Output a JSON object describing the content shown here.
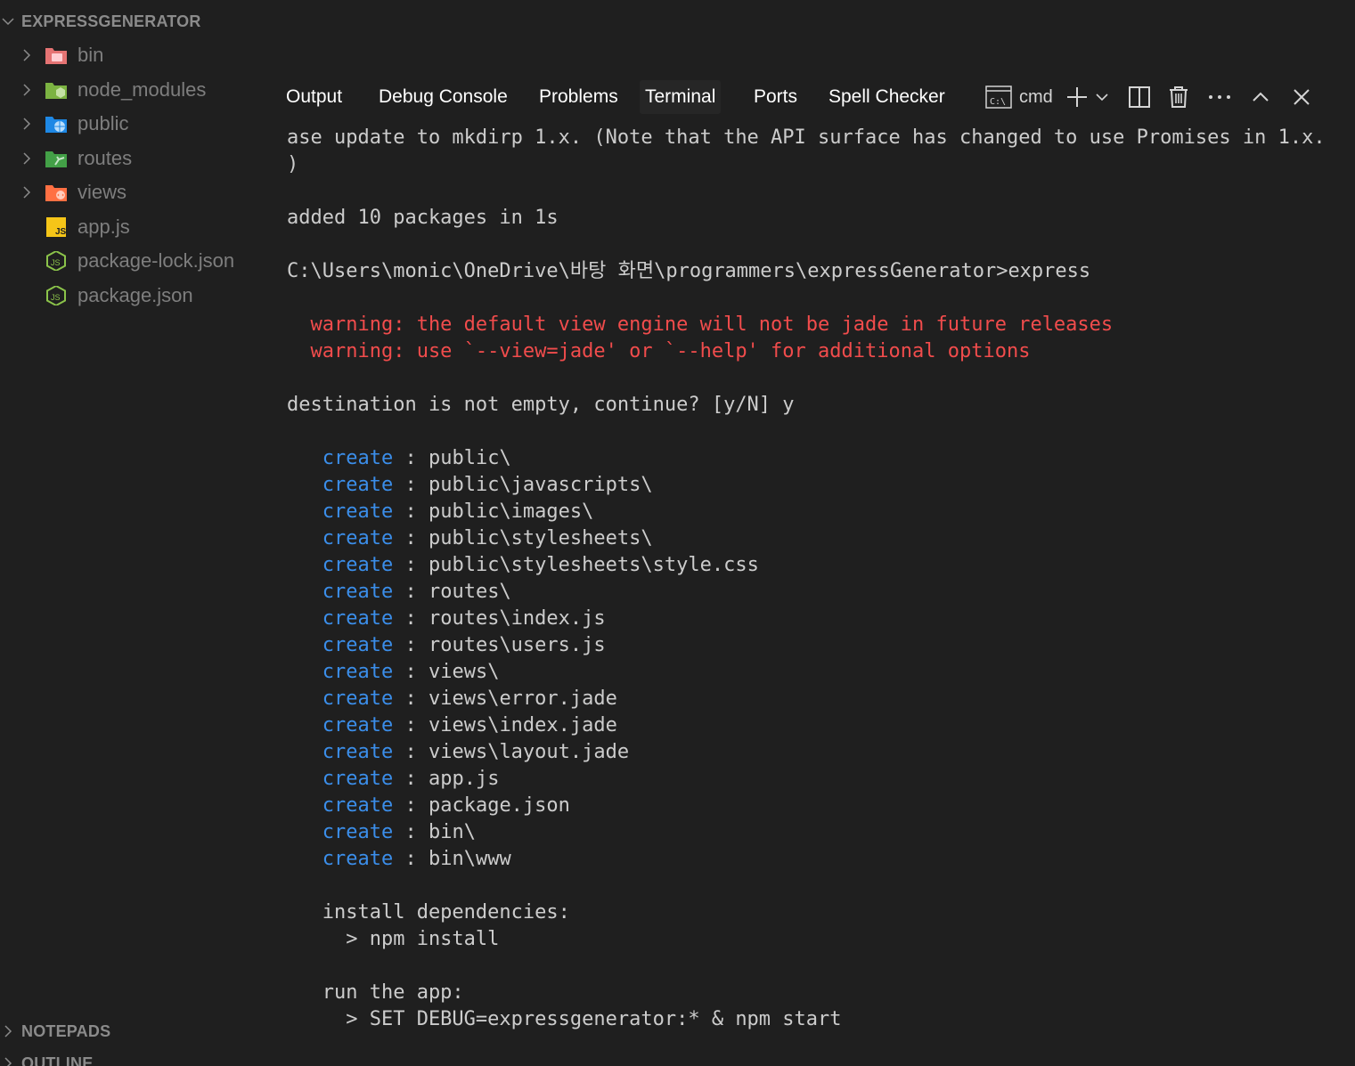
{
  "explorer": {
    "title": "EXPRESSGENERATOR",
    "items": [
      {
        "label": "bin",
        "icon": "folder-bin-icon"
      },
      {
        "label": "node_modules",
        "icon": "folder-node-icon"
      },
      {
        "label": "public",
        "icon": "folder-public-icon"
      },
      {
        "label": "routes",
        "icon": "folder-routes-icon"
      },
      {
        "label": "views",
        "icon": "folder-views-icon"
      },
      {
        "label": "app.js",
        "icon": "js-file-icon"
      },
      {
        "label": "package-lock.json",
        "icon": "nodejs-file-icon"
      },
      {
        "label": "package.json",
        "icon": "nodejs-file-icon"
      }
    ],
    "notepads_label": "NOTEPADS",
    "outline_label": "OUTLINE"
  },
  "panel": {
    "tabs": [
      {
        "label": "Output",
        "active": false
      },
      {
        "label": "Debug Console",
        "active": false
      },
      {
        "label": "Problems",
        "active": false
      },
      {
        "label": "Terminal",
        "active": true
      },
      {
        "label": "Ports",
        "active": false
      },
      {
        "label": "Spell Checker",
        "active": false
      }
    ],
    "shell_label": "cmd"
  },
  "terminal": {
    "lines": {
      "l1": "ase update to mkdirp 1.x. (Note that the API surface has changed to use Promises in 1.x.",
      "l2": ")",
      "l3": "added 10 packages in 1s",
      "l4": "C:\\Users\\monic\\OneDrive\\바탕 화면\\programmers\\expressGenerator>express",
      "warn1": "  warning: the default view engine will not be jade in future releases",
      "warn2": "  warning: use `--view=jade' or `--help' for additional options",
      "l5": "destination is not empty, continue? [y/N] y",
      "install_header": "   install dependencies:",
      "install_cmd": "     > npm install",
      "run_header": "   run the app:",
      "run_cmd": "     > SET DEBUG=expressgenerator:* & npm start"
    },
    "create_keyword": "create",
    "create_paths": [
      "public\\",
      "public\\javascripts\\",
      "public\\images\\",
      "public\\stylesheets\\",
      "public\\stylesheets\\style.css",
      "routes\\",
      "routes\\index.js",
      "routes\\users.js",
      "views\\",
      "views\\error.jade",
      "views\\index.jade",
      "views\\layout.jade",
      "app.js",
      "package.json",
      "bin\\",
      "bin\\www"
    ]
  },
  "colors": {
    "background": "#1f1f1f",
    "warning": "#f14c4c",
    "create_keyword": "#3b8eea"
  }
}
